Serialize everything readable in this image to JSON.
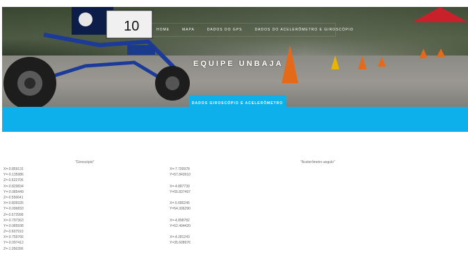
{
  "nav": {
    "items": [
      "HOME",
      "MAPA",
      "DADOS DO GPS",
      "DADOS DO ACELERÔMETRO E GIROSCÓPIO"
    ]
  },
  "hero": {
    "title": "EQUIPE UNBAJA",
    "car_number": "10"
  },
  "section_tab": "DADOS GIROSCÓPIO E ACELERÔMETRO",
  "gyro": {
    "title": "\"Giroscópio\"",
    "lines": [
      "X=-0.859131",
      "Y=-0.135986",
      "Z=-0.522705",
      "X=-0.829834",
      "Y=-0.085449",
      "Z=-0.556641",
      "X=-0.809326",
      "Y=-0.096833",
      "Z=-0.572998",
      "X=-0.797363",
      "Y=-0.085938",
      "Z=-0.607910",
      "X=-0.759766",
      "Y=-0.097412",
      "Z=-1.056396"
    ]
  },
  "accel": {
    "lines": [
      "X=-7.700978",
      "Y=57.843910",
      "",
      "X=-4.887730",
      "Y=55.837497",
      "",
      "X=-5.680245",
      "Y=54.306290",
      "",
      "X=-4.898782",
      "Y=52.404420",
      "",
      "X=-4.281243",
      "Y=35.608976",
      ""
    ]
  },
  "accel_angle": {
    "title": "\"Acelerômetro angulo\""
  },
  "colors": {
    "accent": "#0db0ea",
    "text": "#666666"
  }
}
